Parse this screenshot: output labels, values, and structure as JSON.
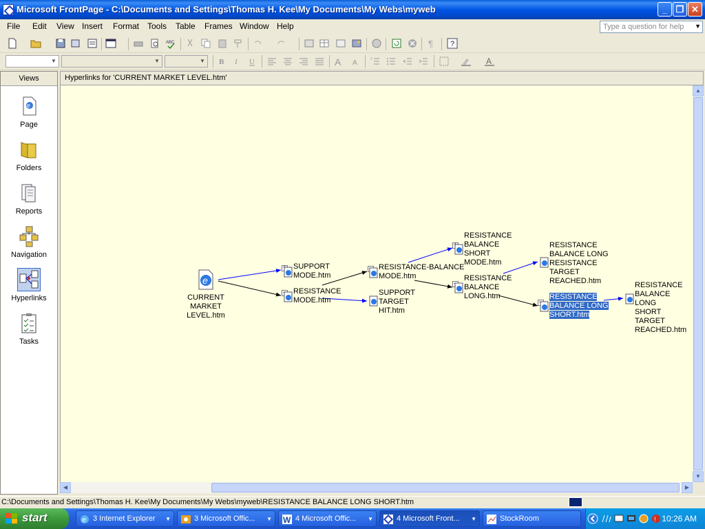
{
  "window": {
    "title": "Microsoft FrontPage - C:\\Documents and Settings\\Thomas H. Kee\\My Documents\\My Webs\\myweb",
    "minimize": "_",
    "restore": "❐",
    "close": "✕"
  },
  "menu": {
    "items": [
      "File",
      "Edit",
      "View",
      "Insert",
      "Format",
      "Tools",
      "Table",
      "Frames",
      "Window",
      "Help"
    ],
    "help_placeholder": "Type a question for help"
  },
  "views": {
    "header": "Views",
    "items": [
      {
        "label": "Page",
        "icon": "page-view-icon"
      },
      {
        "label": "Folders",
        "icon": "folder-icon"
      },
      {
        "label": "Reports",
        "icon": "reports-icon"
      },
      {
        "label": "Navigation",
        "icon": "navigation-icon"
      },
      {
        "label": "Hyperlinks",
        "icon": "hyperlinks-icon",
        "selected": true
      },
      {
        "label": "Tasks",
        "icon": "tasks-icon"
      }
    ]
  },
  "main": {
    "header": "Hyperlinks for 'CURRENT MARKET LEVEL.htm'",
    "nodes": {
      "current": "CURRENT MARKET\nLEVEL.htm",
      "support_mode": "SUPPORT\nMODE.htm",
      "resistance_mode": "RESISTANCE\nMODE.htm",
      "resistance_balance_mode": "RESISTANCE-BALANCE\nMODE.htm",
      "support_target_hit": "SUPPORT\nTARGET\nHIT.htm",
      "rb_short_mode": "RESISTANCE\nBALANCE\nSHORT\nMODE.htm",
      "rb_long": "RESISTANCE\nBALANCE\nLONG.htm",
      "rbl_resistance_target": "RESISTANCE\nBALANCE LONG\nRESISTANCE\nTARGET\nREACHED.htm",
      "rbl_short": "RESISTANCE\nBALANCE LONG\nSHORT.htm",
      "rbl_short_target": "RESISTANCE\nBALANCE LONG\nSHORT TARGET\nREACHED.htm"
    }
  },
  "status": {
    "path": "C:\\Documents and Settings\\Thomas H. Kee\\My Documents\\My Webs\\myweb\\RESISTANCE BALANCE LONG SHORT.htm"
  },
  "taskbar": {
    "start": "start",
    "tasks": [
      {
        "label": "3 Internet Explorer",
        "active": false
      },
      {
        "label": "3 Microsoft Offic...",
        "active": false
      },
      {
        "label": "4 Microsoft Offic...",
        "active": false
      },
      {
        "label": "4 Microsoft Front...",
        "active": true
      },
      {
        "label": "StockRoom",
        "active": false
      }
    ],
    "clock": "10:26 AM"
  },
  "colors": {
    "titlebar": "#0055e5",
    "canvas_bg": "#ffffe1",
    "link_blue": "#0000ff",
    "selection": "#316ac5"
  }
}
